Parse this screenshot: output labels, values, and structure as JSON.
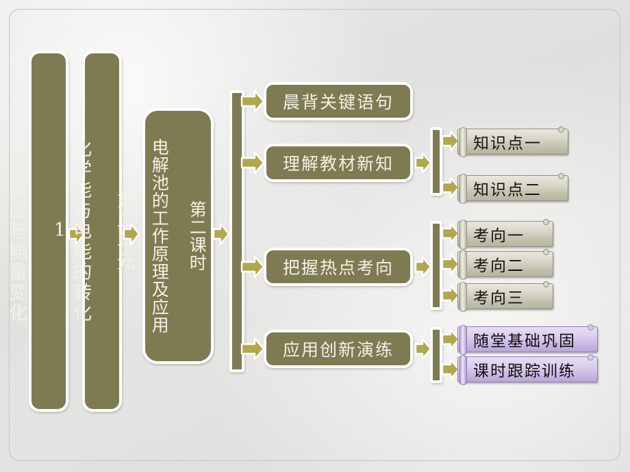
{
  "slide": {
    "kind": "lesson-outline-flowchart",
    "colors": {
      "olive_fill": "#7e7b52",
      "arrow_fill": "#b0a84c",
      "node_border": "#ffffff",
      "background": "#e2e2e0",
      "scroll_tan": "#d8d6c8",
      "scroll_purple": "#cfc0e8",
      "text_light": "#f2f1e6",
      "text_dark": "#14140f"
    }
  },
  "column1": {
    "topic": {
      "label": "专题\n1\n\n化学反应与能量变化",
      "line1": "专题 1",
      "line2": "化学反应与能量变化"
    },
    "unit": {
      "label": "第二单元\n\n化学能与电能的转化",
      "line1": "第二单元",
      "line2": "化学能与电能的转化"
    },
    "lesson": {
      "label": "第二课时\n\n电解池的工作原理及应用",
      "line1": "第二课时",
      "line2": "电解池的工作原理及应用"
    }
  },
  "branches": [
    {
      "label": "晨背关键语句",
      "children": []
    },
    {
      "label": "理解教材新知",
      "children": [
        "知识点一",
        "知识点二"
      ]
    },
    {
      "label": "把握热点考向",
      "children": [
        "考向一",
        "考向二",
        "考向三"
      ]
    },
    {
      "label": "应用创新演练",
      "children": [
        "随堂基础巩固",
        "课时跟踪训练"
      ]
    }
  ],
  "knowledge_points": {
    "point1": "知识点一",
    "point2": "知识点二"
  },
  "exam_directions": {
    "dir1": "考向一",
    "dir2": "考向二",
    "dir3": "考向三"
  },
  "practice": {
    "item1": "随堂基础巩固",
    "item2": "课时跟踪训练"
  },
  "middle_nodes": {
    "recite": "晨背关键语句",
    "learn": "理解教材新知",
    "focus": "把握热点考向",
    "drill": "应用创新演练"
  },
  "icons": {
    "arrow": "right-arrow-icon"
  }
}
